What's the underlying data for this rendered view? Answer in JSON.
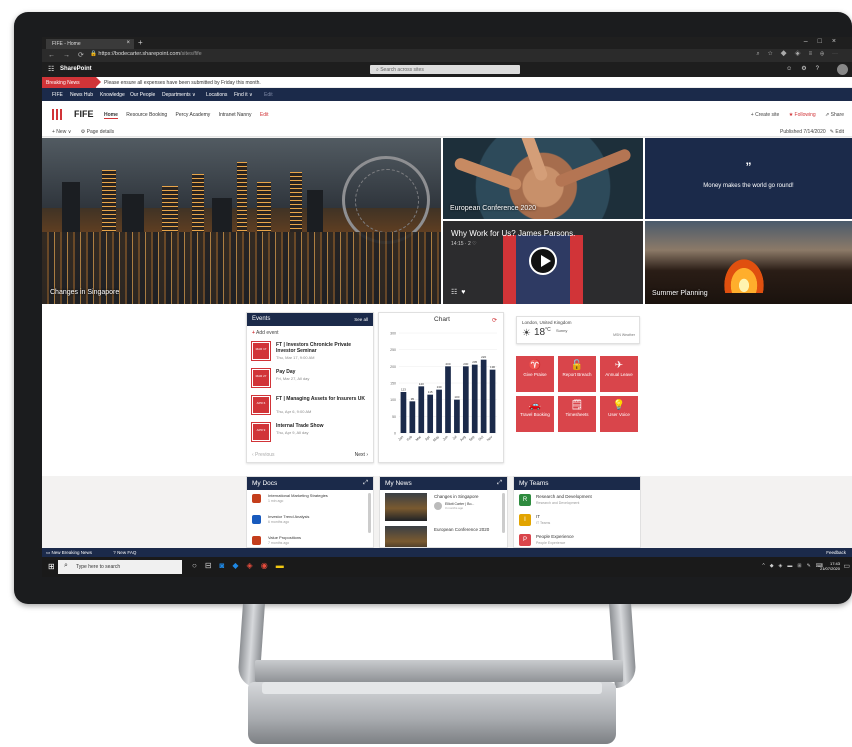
{
  "browser": {
    "tab_title": "FIFE - Home",
    "url_host": "https://bodecarter.sharepoint.com",
    "url_path": "/sites/fife"
  },
  "suite": {
    "brand": "SharePoint",
    "search_placeholder": "Search across sites"
  },
  "breaking": {
    "tag": "Breaking News",
    "message": "Please ensure all expenses have been submitted by Friday this month."
  },
  "hubnav": {
    "items": [
      "FIFE",
      "News Hub",
      "Knowledge",
      "Our People",
      "Departments ∨",
      "Locations",
      "Find it ∨",
      "Edit"
    ]
  },
  "site": {
    "title": "FIFE",
    "nav": [
      "Home",
      "Resource Booking",
      "Percy Academy",
      "Intranet Nanny",
      "Edit"
    ],
    "actions": [
      "+ Create site",
      "★ Following",
      "⇗ Share"
    ]
  },
  "cmdbar": {
    "new": "+ New ∨",
    "details": "⚙ Page details",
    "published": "Published 7/14/2020",
    "edit": "✎ Edit"
  },
  "hero": {
    "main_caption": "Changes in Singapore",
    "tile1_caption": "European Conference 2020",
    "quote_mark": "”",
    "quote_text": "Money makes the world go round!",
    "video_title": "Why Work for Us? James Parsons.",
    "video_meta": "14:15 · 2 ♡",
    "tile4_caption": "Summer Planning"
  },
  "events": {
    "title": "Events",
    "see_all": "See all",
    "add": "Add event",
    "items": [
      {
        "date": "MAR 17",
        "title": "FT | Investors Chronicle Private Investor Seminar",
        "sub": "Thu, Mar 17, 9:00 AM"
      },
      {
        "date": "MAR 27",
        "title": "Pay Day",
        "sub": "Fri, Mar 27, All day"
      },
      {
        "date": "APR 6",
        "title": "FT | Managing Assets for Insurers UK",
        "sub": "Thu, Apr 6, 9:00 AM"
      },
      {
        "date": "APR 9",
        "title": "Internal Trade Show",
        "sub": "Thu, Apr 9, All day"
      }
    ],
    "previous": "‹ Previous",
    "next": "Next ›"
  },
  "chart_data": {
    "type": "bar",
    "title": "Chart",
    "categories": [
      "Jan",
      "Feb",
      "Mar",
      "Apr",
      "May",
      "Jun",
      "Jul",
      "Aug",
      "Sep",
      "Oct",
      "Nov"
    ],
    "values": [
      123,
      95,
      140,
      115,
      130,
      200,
      100,
      200,
      205,
      220,
      190
    ],
    "ylim": [
      0,
      300
    ],
    "yticks": [
      0,
      50,
      100,
      150,
      200,
      250,
      300
    ],
    "bar_color": "#1b2a4a"
  },
  "weather": {
    "location": "London, United Kingdom",
    "temp": "18",
    "unit": "°C",
    "condition": "Sunny",
    "source": "MSN Weather"
  },
  "quicklinks": [
    {
      "icon": "♈",
      "label": "Give Praise"
    },
    {
      "icon": "🔓",
      "label": "Report Breach"
    },
    {
      "icon": "✈",
      "label": "Annual Leave"
    },
    {
      "icon": "🚗",
      "label": "Travel Booking"
    },
    {
      "icon": "🗒",
      "label": "Timesheets"
    },
    {
      "icon": "💡",
      "label": "User Voice"
    }
  ],
  "mydocs": {
    "title": "My Docs",
    "items": [
      {
        "name": "International Marketing Strategies",
        "when": "1 min ago",
        "color": "#c43e1c"
      },
      {
        "name": "Investor Trend Analysis",
        "when": "6 months ago",
        "color": "#185abd"
      },
      {
        "name": "Value Propositions",
        "when": "7 months ago",
        "color": "#c43e1c"
      }
    ]
  },
  "mynews": {
    "title": "My News",
    "items": [
      {
        "title": "Changes in Singapore",
        "author": "Elliott Carter | Bo...",
        "ago": "3 months ago"
      },
      {
        "title": "European Conference 2020",
        "author": "",
        "ago": ""
      }
    ]
  },
  "myteams": {
    "title": "My Teams",
    "items": [
      {
        "name": "Research and Development",
        "sub": "Research and Development",
        "color": "#2e8b3e",
        "initial": "R"
      },
      {
        "name": "IT",
        "sub": "IT Teams",
        "color": "#e2a400",
        "initial": "I"
      },
      {
        "name": "People Experience",
        "sub": "People Experience",
        "color": "#d9454b",
        "initial": "P"
      }
    ]
  },
  "feedbar": {
    "new_breaking": "New Breaking News",
    "new_faq": "New FAQ",
    "feedback": "Feedback"
  },
  "taskbar": {
    "search_placeholder": "Type here to search",
    "time": "17:43",
    "date": "21/07/2020"
  }
}
